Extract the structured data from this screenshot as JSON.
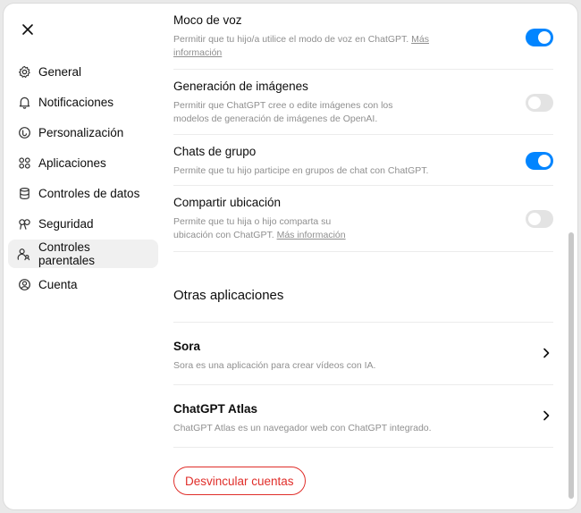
{
  "sidebar": {
    "close_label": "Cerrar",
    "items": [
      {
        "label": "General",
        "icon": "gear-icon"
      },
      {
        "label": "Notificaciones",
        "icon": "bell-icon"
      },
      {
        "label": "Personalización",
        "icon": "personalization-icon"
      },
      {
        "label": "Aplicaciones",
        "icon": "apps-icon"
      },
      {
        "label": "Controles de datos",
        "icon": "database-icon"
      },
      {
        "label": "Seguridad",
        "icon": "key-icon"
      },
      {
        "label": "Controles parentales",
        "icon": "parental-icon",
        "active": true
      },
      {
        "label": "Cuenta",
        "icon": "account-icon"
      }
    ]
  },
  "settings": [
    {
      "title": "Moco de voz",
      "desc": "Permitir que tu hijo/a utilice el modo de voz en ChatGPT.",
      "link": "Más información",
      "enabled": true
    },
    {
      "title": "Generación de imágenes",
      "desc": "Permitir que ChatGPT cree o edite imágenes con los modelos de generación de imágenes de OpenAI.",
      "link": "",
      "enabled": false
    },
    {
      "title": "Chats de grupo",
      "desc": "Permite que tu hijo participe en grupos de chat con ChatGPT.",
      "link": "",
      "enabled": true
    },
    {
      "title": "Compartir ubicación",
      "desc": "Permite que tu hija o hijo comparta su ubicación con ChatGPT.",
      "link": "Más información",
      "enabled": false
    }
  ],
  "other_apps": {
    "title": "Otras aplicaciones",
    "apps": [
      {
        "name": "Sora",
        "desc": "Sora es una aplicación para crear vídeos con IA."
      },
      {
        "name": "ChatGPT Atlas",
        "desc": "ChatGPT Atlas es un navegador web con ChatGPT integrado."
      }
    ]
  },
  "actions": {
    "unlink_label": "Desvincular cuentas"
  },
  "colors": {
    "toggle_on": "#0285ff",
    "toggle_off": "#e3e3e3",
    "danger": "#e02e2a"
  }
}
